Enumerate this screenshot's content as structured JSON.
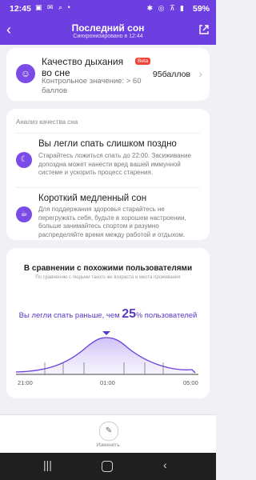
{
  "status": {
    "time": "12:45",
    "notif_icons": [
      "gallery-icon",
      "message-icon",
      "search-icon",
      "dot-icon"
    ],
    "battery": "59%"
  },
  "header": {
    "title": "Последний сон",
    "subtitle": "Синхронизировано в 12:44"
  },
  "breathing": {
    "title": "Качество дыхания во сне",
    "badge": "Beta",
    "reference": "Контрольное значение: > 60 баллов",
    "score": "95баллов"
  },
  "analysis": {
    "heading": "Анализ качества сна",
    "items": [
      {
        "title": "Вы легли спать слишком поздно",
        "desc": "Старайтесь ложиться спать до 22:00. Засиживание допоздна может нанести вред вашей иммунной системе и ускорить процесс старения.",
        "icon": "moon-icon"
      },
      {
        "title": "Короткий медленный сон",
        "desc": "Для поддержания здоровья старайтесь не перегружать себя, будьте в хорошем настроении, больше занимайтесь спортом и разумно распределяйте время между работой и отдыхом.",
        "icon": "cup-icon"
      }
    ]
  },
  "comparison": {
    "title": "В сравнении с похожими пользователями",
    "subtitle": "По сравнению с людьми такого же возраста и места проживания",
    "result_prefix": "Вы легли спать раньше, чем",
    "result_value": "25",
    "result_unit": "%",
    "result_suffix": "пользователей",
    "axis_ticks": [
      "21:00",
      "01:00",
      "05:00"
    ]
  },
  "footer": {
    "edit_label": "Изменить"
  },
  "colors": {
    "accent": "#6d3fe0",
    "icon_bg": "#7b4be6",
    "badge": "#f0453a",
    "result_text": "#5a39c4"
  }
}
